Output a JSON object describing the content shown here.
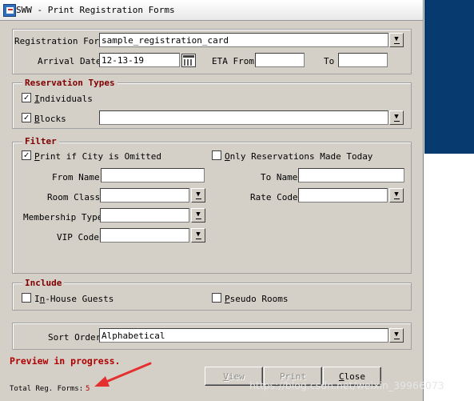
{
  "window": {
    "title": "SWW - Print Registration Forms"
  },
  "registration_form": {
    "label": "Registration Form",
    "value": "sample_registration_card"
  },
  "dates": {
    "arrival_label": "Arrival Date",
    "arrival_value": "12-13-19",
    "eta_from_label": "ETA From",
    "eta_from_value": "",
    "to_label": "To",
    "to_value": ""
  },
  "reservation_types": {
    "legend": "Reservation Types",
    "individuals": {
      "label_u": "I",
      "label_rest": "ndividuals",
      "checked": true
    },
    "blocks": {
      "label_u": "B",
      "label_rest": "locks",
      "checked": true,
      "value": ""
    }
  },
  "filter": {
    "legend": "Filter",
    "print_if_city_omitted": {
      "label_u": "P",
      "label_rest": "rint if City is Omitted",
      "checked": true
    },
    "only_today": {
      "label_u": "O",
      "label_rest": "nly Reservations Made Today",
      "checked": false
    },
    "from_name_label": "From Name",
    "from_name_value": "",
    "to_name_label": "To Name",
    "to_name_value": "",
    "room_class_label": "Room Class",
    "room_class_value": "",
    "rate_code_label": "Rate Code",
    "rate_code_value": "",
    "membership_type_label": "Membership Type",
    "membership_type_value": "",
    "vip_code_label": "VIP Code",
    "vip_code_value": ""
  },
  "include": {
    "legend": "Include",
    "in_house": {
      "label_pre": "I",
      "label_u": "n",
      "label_rest": "-House Guests",
      "checked": false
    },
    "pseudo": {
      "label_u": "P",
      "label_rest": "seudo Rooms",
      "checked": false
    }
  },
  "sort": {
    "label": "Sort Order",
    "value": "Alphabetical"
  },
  "status": {
    "message": "Preview in progress.",
    "total_label": "Total Reg. Forms:",
    "total_value": "5"
  },
  "buttons": {
    "view": {
      "label_u": "V",
      "label_rest": "iew",
      "enabled": false
    },
    "print": {
      "label": "Print",
      "enabled": false
    },
    "close": {
      "label_u": "C",
      "label_rest": "lose",
      "enabled": true
    }
  },
  "checkmark_glyph": "✓",
  "watermark": "https://blog.csdn.net/weixin_39966073",
  "colors": {
    "dialog_bg": "#d4d0c8",
    "legend_text": "#800000",
    "status_text": "#b00000",
    "annotation_arrow": "#e53030",
    "side_panel": "#073a6e"
  }
}
